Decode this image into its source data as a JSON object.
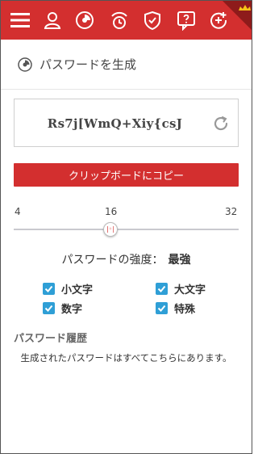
{
  "toolbar": {
    "icons": [
      "hamburger-menu-icon",
      "user-icon",
      "password-generator-icon",
      "breach-monitor-icon",
      "shield-icon",
      "help-icon",
      "add-icon",
      "crown-icon"
    ],
    "accent_color": "#d32f2f",
    "premium_color": "#f5c518"
  },
  "title": "パスワードを生成",
  "password": {
    "value": "Rs7j[WmQ+Xiy{csJ"
  },
  "copy_button": "クリップボードにコピー",
  "slider": {
    "min": "4",
    "current": "16",
    "max": "32",
    "value": 16
  },
  "strength": {
    "label": "パスワードの強度：",
    "value": "最強"
  },
  "options": {
    "lowercase": "小文字",
    "uppercase": "大文字",
    "digits": "数字",
    "special": "特殊",
    "checkbox_color": "#2f9fd6"
  },
  "history": {
    "title": "パスワード履歴",
    "message": "生成されたパスワードはすべてこちらにあります。"
  }
}
